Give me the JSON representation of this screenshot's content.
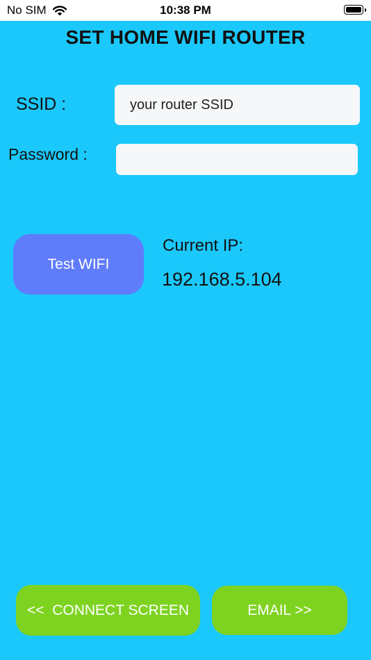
{
  "status_bar": {
    "carrier": "No SIM",
    "time": "10:38 PM",
    "wifi_icon": "wifi-icon",
    "battery_icon": "battery-icon"
  },
  "header": {
    "title": "SET HOME WIFI ROUTER"
  },
  "form": {
    "ssid_label": "SSID :",
    "ssid_placeholder": "your router SSID",
    "password_label": "Password :",
    "password_placeholder": ""
  },
  "test": {
    "button_label": "Test WIFI",
    "current_ip_label": "Current IP:",
    "current_ip_value": "192.168.5.104"
  },
  "footer": {
    "connect_label": "<<  CONNECT SCREEN",
    "email_label": "EMAIL >>"
  },
  "colors": {
    "background": "#1bc8fb",
    "test_button": "#5f7cfb",
    "nav_button": "#7ed321",
    "field_background": "#f5f7f9"
  }
}
